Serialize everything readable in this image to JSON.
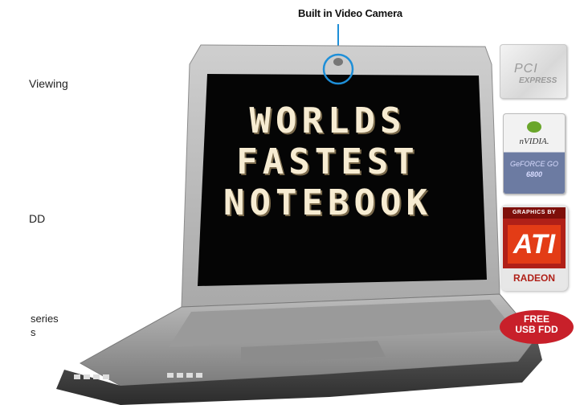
{
  "callout": {
    "label": "Built in Video Camera"
  },
  "screen": {
    "lines": [
      "WORLDS",
      "FASTEST",
      "NOTEBOOK"
    ]
  },
  "side_fragments": [
    "Viewing",
    "DD",
    "series",
    "s"
  ],
  "badges": {
    "pci": {
      "line1": "PCI",
      "line2": "EXPRESS"
    },
    "nvidia": {
      "brand": "nVIDIA.",
      "line1": "GeFORCE GO",
      "line2": "6800"
    },
    "ati": {
      "top": "GRAPHICS BY",
      "mid": "ATI",
      "bottom": "RADEON"
    },
    "fdd": {
      "line1": "FREE",
      "line2": "USB FDD"
    }
  },
  "colors": {
    "camera_ring": "#1e8fd8",
    "fdd_bg": "#c8202a",
    "ati_red": "#b02018"
  }
}
